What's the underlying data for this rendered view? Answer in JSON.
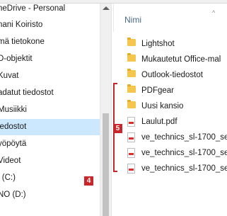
{
  "nav": {
    "items": [
      {
        "label": "neDrive - Personal"
      },
      {
        "label": "nani Koiristo"
      },
      {
        "label": "mä tietokone"
      },
      {
        "label": "D-objektit"
      },
      {
        "label": "Kuvat"
      },
      {
        "label": "adatut tiedostot"
      },
      {
        "label": "Musiikki"
      },
      {
        "label": "iedostot"
      },
      {
        "label": "yöpöytä"
      },
      {
        "label": "Videot"
      },
      {
        "label": "l (C:)"
      },
      {
        "label": "NO (D:)"
      }
    ]
  },
  "content": {
    "column_header": "Nimi",
    "files": [
      {
        "name": "Lightshot",
        "icon": "folder-icon"
      },
      {
        "name": "Mukautetut Office-mal",
        "icon": "folder-icon"
      },
      {
        "name": "Outlook-tiedostot",
        "icon": "folder-icon"
      },
      {
        "name": "PDFgear",
        "icon": "folder-icon"
      },
      {
        "name": "Uusi kansio",
        "icon": "folder-icon"
      },
      {
        "name": "Laulut.pdf",
        "icon": "pdf-icon"
      },
      {
        "name": "ve_technics_sl-1700_ser",
        "icon": "pdf-icon"
      },
      {
        "name": "ve_technics_sl-1700_ser",
        "icon": "pdf-icon"
      },
      {
        "name": "ve_technics_sl-1700_ser",
        "icon": "pdf-icon"
      }
    ]
  },
  "annotations": {
    "badge_nav": "4",
    "badge_files": "5",
    "accent_color": "#c9262a"
  }
}
